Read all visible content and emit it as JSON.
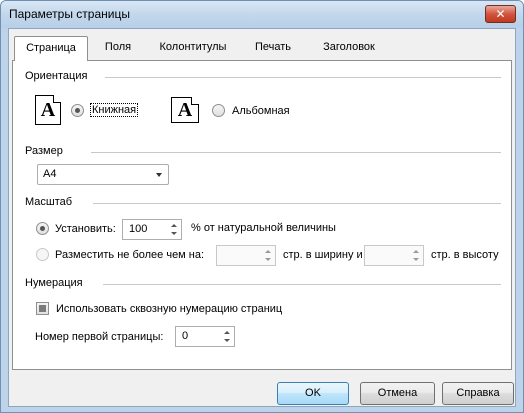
{
  "window": {
    "title": "Параметры страницы",
    "close_label": "✕"
  },
  "tabs": [
    "Страница",
    "Поля",
    "Колонтитулы",
    "Печать",
    "Заголовок"
  ],
  "orientation": {
    "section_label": "Ориентация",
    "portrait_label": "Книжная",
    "landscape_label": "Альбомная",
    "icon_glyph": "A",
    "selected": "portrait"
  },
  "size": {
    "section_label": "Размер",
    "value": "A4"
  },
  "scale": {
    "section_label": "Масштаб",
    "set_label": "Установить:",
    "set_value": "100",
    "set_suffix": "% от натуральной величины",
    "fit_label": "Разместить не более чем на:",
    "fit_width_value": "",
    "fit_width_suffix": "стр. в ширину и",
    "fit_height_value": "",
    "fit_height_suffix": "стр. в высоту",
    "selected": "set"
  },
  "numbering": {
    "section_label": "Нумерация",
    "continuous_label": "Использовать сквозную нумерацию страниц",
    "first_page_label": "Номер первой страницы:",
    "first_page_value": "0"
  },
  "buttons": {
    "ok": "OK",
    "cancel": "Отмена",
    "help": "Справка"
  }
}
